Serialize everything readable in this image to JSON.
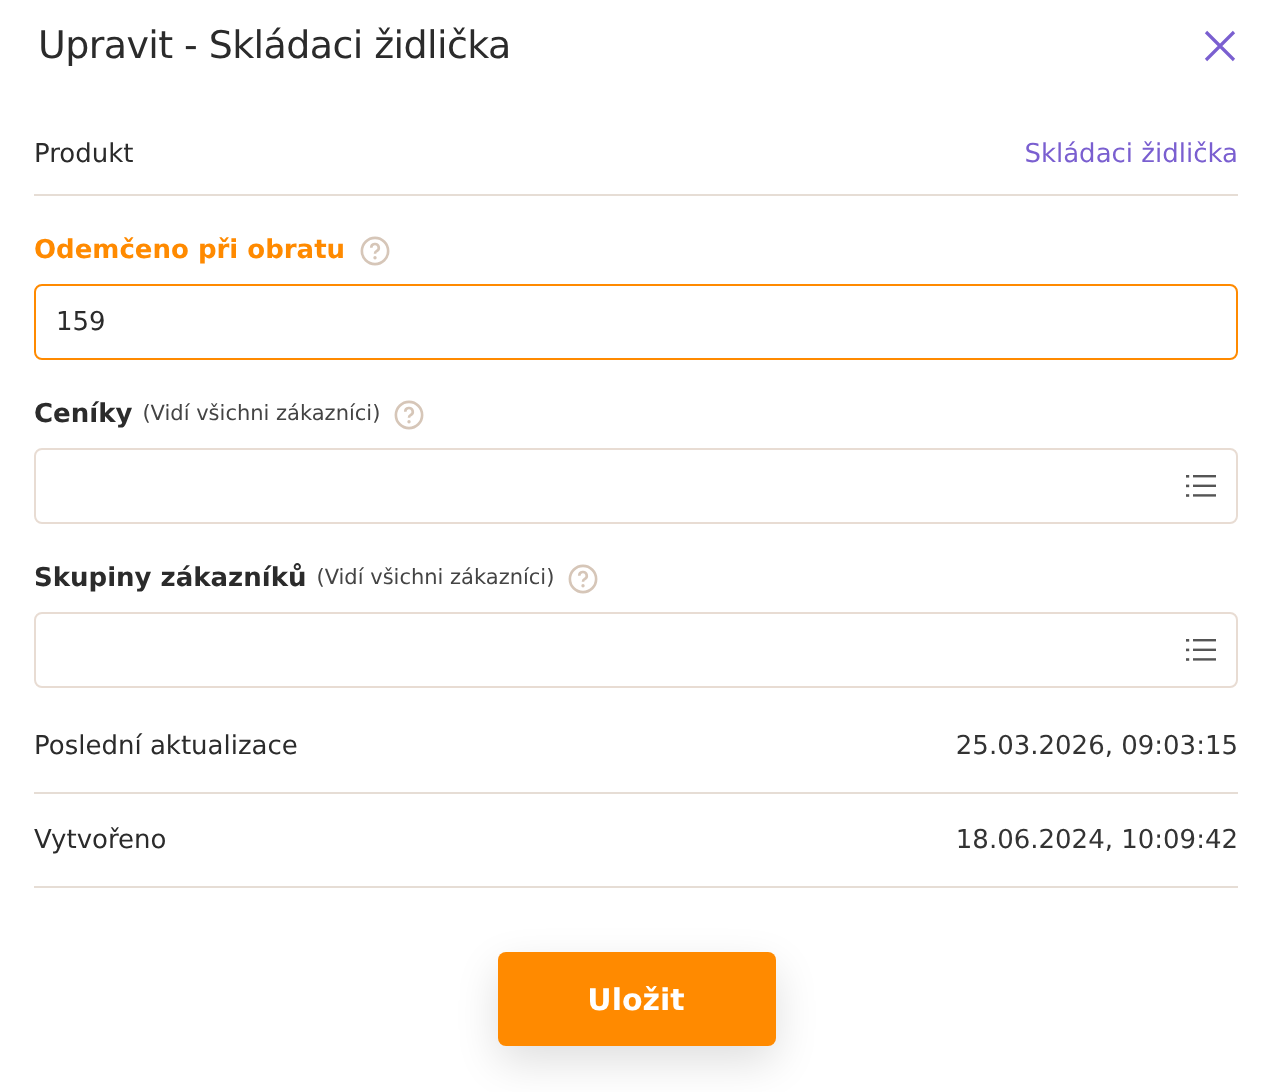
{
  "dialog": {
    "title": "Upravit - Skládaci židlička"
  },
  "product": {
    "label": "Produkt",
    "value": "Skládaci židlička"
  },
  "fields": [
    {
      "kind": "text",
      "label": "Odemčeno při obratu",
      "value": "159",
      "focused": true
    },
    {
      "kind": "select",
      "label": "Ceníky",
      "note": "(Vidí všichni zákazníci)",
      "focused": false
    },
    {
      "kind": "select",
      "label": "Skupiny zákazníků",
      "note": "(Vidí všichni zákazníci)",
      "focused": false
    }
  ],
  "info_rows": [
    {
      "label": "Poslední aktualizace",
      "value": "25.03.2026, 09:03:15"
    },
    {
      "label": "Vytvořeno",
      "value": "18.06.2024, 10:09:42"
    }
  ],
  "buttons": [
    {
      "label": "Uložit"
    }
  ]
}
